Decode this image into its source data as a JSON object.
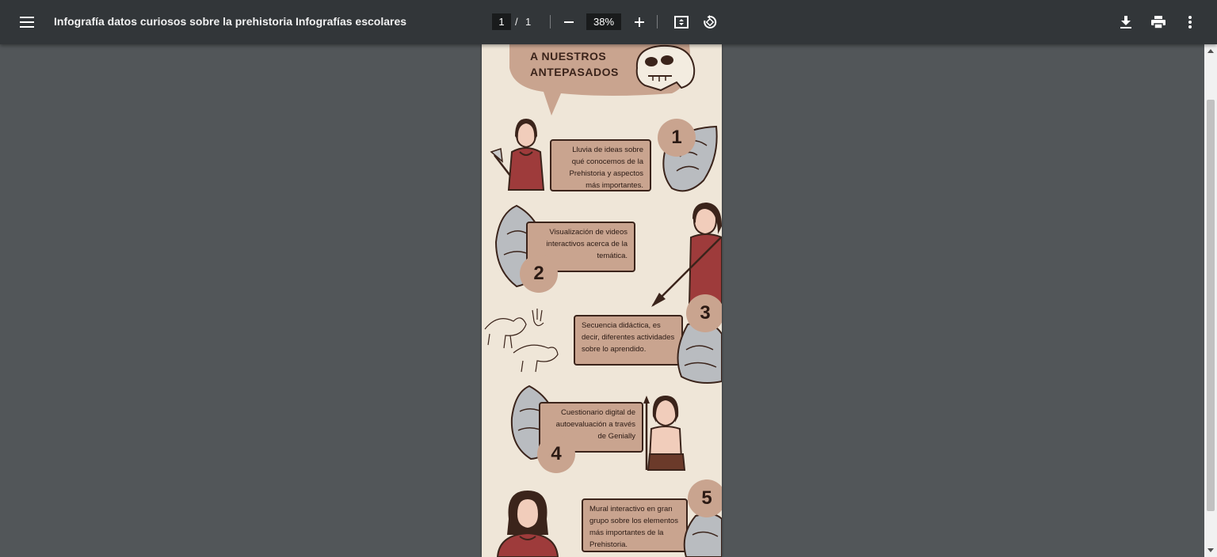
{
  "toolbar": {
    "title": "Infografía datos curiosos sobre la prehistoria Infografías escolares",
    "current_page": "1",
    "page_separator": "/",
    "total_pages": "1",
    "zoom": "38%",
    "icons": [
      "menu-icon",
      "zoom-out-icon",
      "zoom-in-icon",
      "fit-page-icon",
      "rotate-icon",
      "download-icon",
      "print-icon",
      "more-vert-icon"
    ]
  },
  "document": {
    "headline": [
      "A NUESTROS",
      "ANTEPASADOS"
    ],
    "steps": [
      {
        "number": "1",
        "text": "Lluvia de ideas sobre qué conocemos de la Prehistoria y aspectos más importantes."
      },
      {
        "number": "2",
        "text": "Visualización de videos interactivos acerca de la temática."
      },
      {
        "number": "3",
        "text": "Secuencia didáctica, es decir, diferentes actividades sobre lo aprendido."
      },
      {
        "number": "4",
        "text": "Cuestionario digital de autoevaluación a través de Genially"
      },
      {
        "number": "5",
        "text": "Mural interactivo en gran grupo sobre los elementos más importantes de la Prehistoria."
      }
    ]
  },
  "colors": {
    "toolbar_bg": "#323639",
    "viewer_bg": "#525659",
    "page_bg": "#efe6d8",
    "accent_tan": "#c9a48f",
    "dark_brown": "#3b241b",
    "red_cloth": "#9e3b3b"
  }
}
